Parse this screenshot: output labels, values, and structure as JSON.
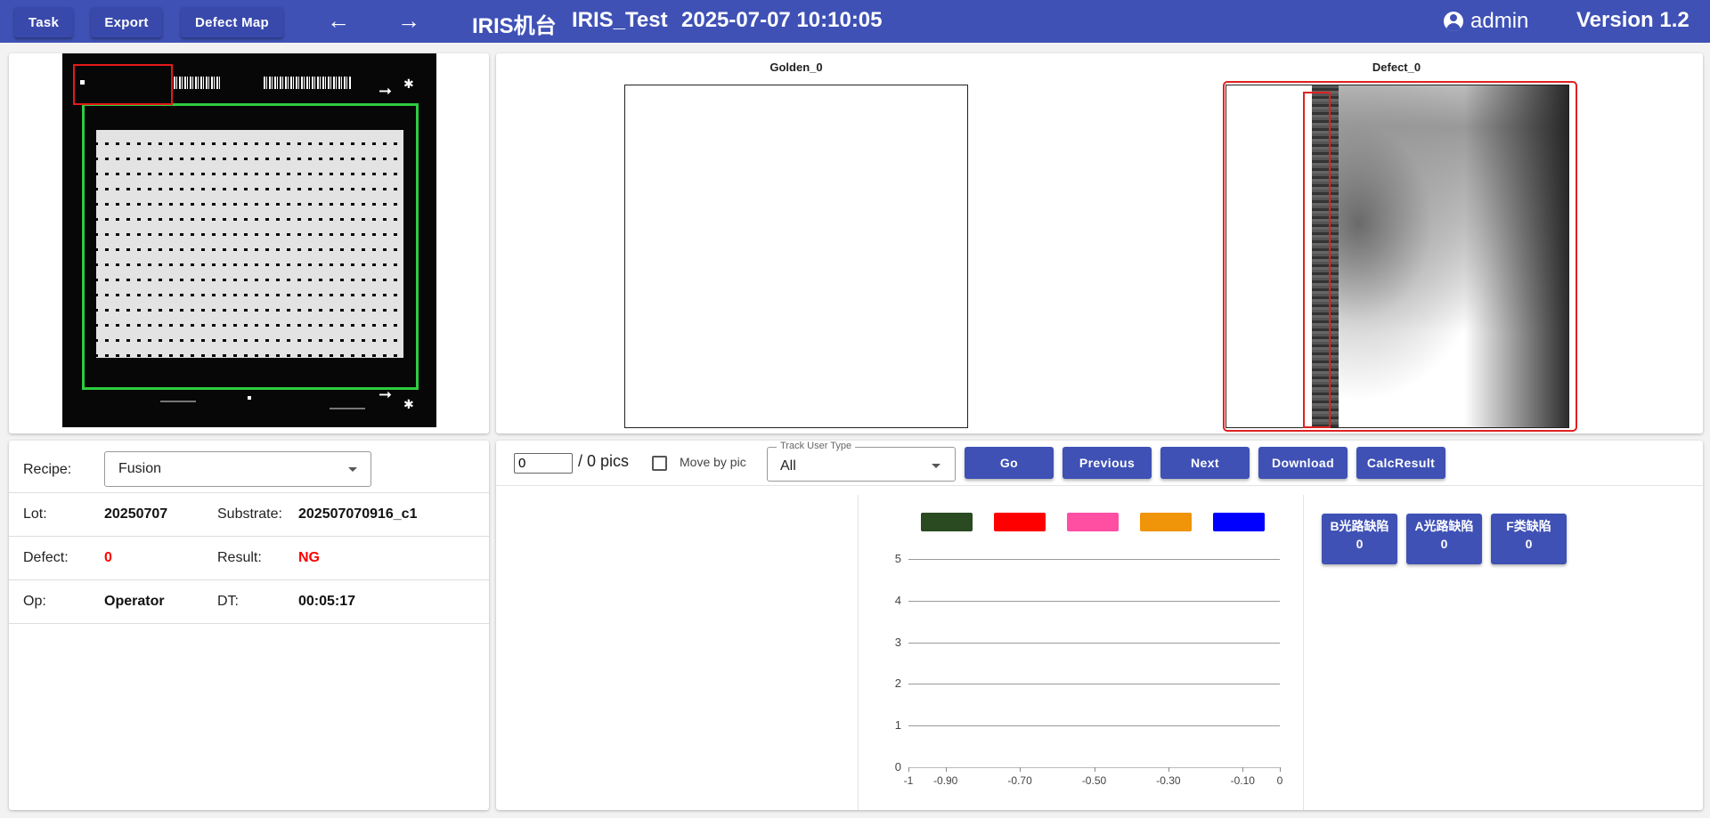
{
  "header": {
    "buttons": [
      "Task",
      "Export",
      "Defect Map"
    ],
    "title_machine": "IRIS机台",
    "title_project": "IRIS_Test",
    "title_datetime": "2025-07-07 10:10:05",
    "user": "admin",
    "version": "Version 1.2",
    "back_icon": "arrow-left-icon",
    "forward_icon": "arrow-right-icon"
  },
  "images": {
    "golden_title": "Golden_0",
    "defect_title": "Defect_0"
  },
  "info": {
    "recipe_label": "Recipe:",
    "recipe_value": "Fusion",
    "lot_label": "Lot:",
    "lot_value": "20250707",
    "substrate_label": "Substrate:",
    "substrate_value": "202507070916_c1",
    "defect_label": "Defect:",
    "defect_value": "0",
    "result_label": "Result:",
    "result_value": "NG",
    "op_label": "Op:",
    "op_value": "Operator",
    "dt_label": "DT:",
    "dt_value": "00:05:17"
  },
  "controls": {
    "pic_index": "0",
    "pics_text": "/ 0 pics",
    "move_by_pic_label": "Move by pic",
    "track_user_type_label": "Track User Type",
    "track_user_type_value": "All",
    "go": "Go",
    "previous": "Previous",
    "next": "Next",
    "download": "Download",
    "calc_result": "CalcResult"
  },
  "chart_data": {
    "type": "bar",
    "series": [
      {
        "color": "#2a4a22",
        "values": []
      },
      {
        "color": "#ff0000",
        "values": []
      },
      {
        "color": "#ff4fa3",
        "values": []
      },
      {
        "color": "#f0940a",
        "values": []
      },
      {
        "color": "#0000ff",
        "values": []
      }
    ],
    "yticks": [
      "0",
      "1",
      "2",
      "3",
      "4",
      "5"
    ],
    "xticks": [
      "-1",
      "-0.90",
      "-0.70",
      "-0.50",
      "-0.30",
      "-0.10",
      "0"
    ],
    "ylim": [
      0,
      5
    ],
    "xlim": [
      -1,
      0
    ],
    "grid": true,
    "legend": "top"
  },
  "stats": [
    {
      "label": "B光路缺陷",
      "count": "0"
    },
    {
      "label": "A光路缺陷",
      "count": "0"
    },
    {
      "label": "F类缺陷",
      "count": "0"
    }
  ],
  "colors": {
    "primary": "#3f51b5",
    "ng": "#ff0000",
    "roi": "#e51a1a",
    "zone": "#2ecc40"
  }
}
